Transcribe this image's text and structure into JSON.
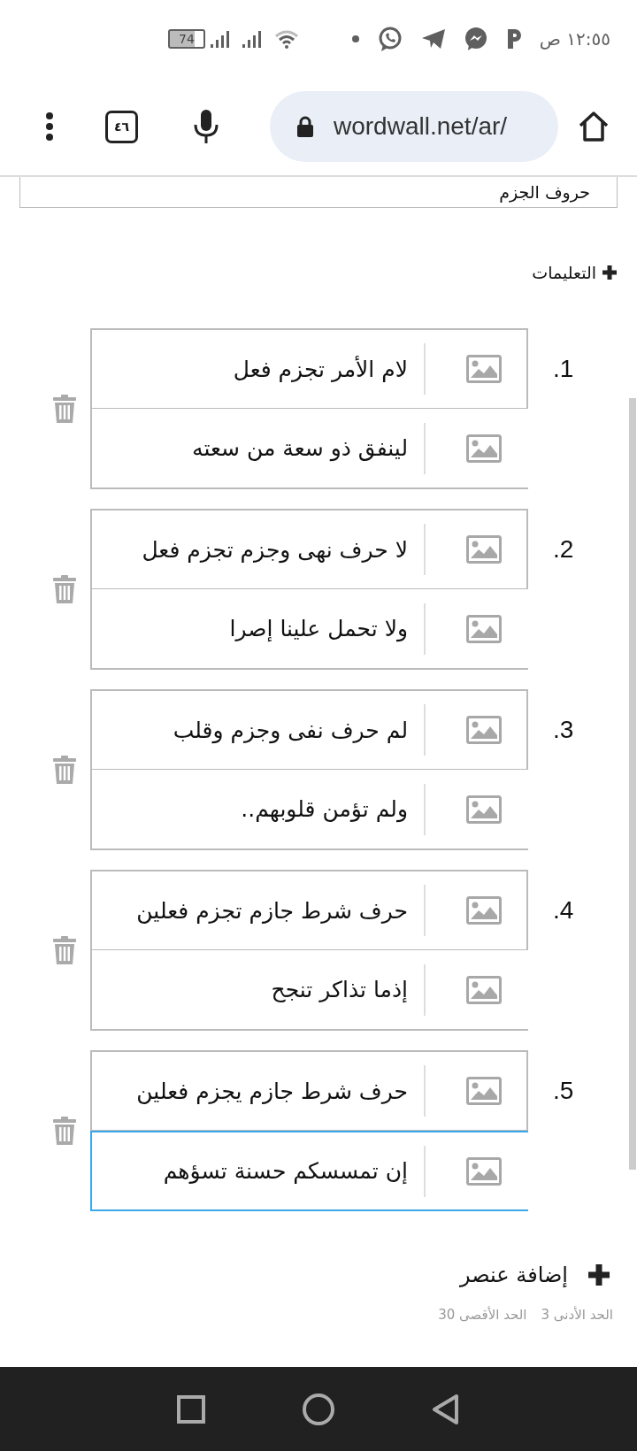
{
  "status_bar": {
    "time": "١٢:٥٥ ص",
    "battery": "74"
  },
  "browser": {
    "url": "wordwall.net/ar/",
    "tab_count": "٤٦"
  },
  "title_field": {
    "value": "حروف الجزم"
  },
  "instructions_button": {
    "label": "التعليمات"
  },
  "items": [
    {
      "number": "1.",
      "question": {
        "value": "لام الأمر تجزم فعل",
        "focused": false
      },
      "answer": {
        "value": "لينفق ذو سعة من سعته",
        "focused": false
      }
    },
    {
      "number": "2.",
      "question": {
        "value": "لا حرف نهى وجزم تجزم فعل",
        "focused": false
      },
      "answer": {
        "value": "ولا تحمل علينا إصرا",
        "focused": false
      }
    },
    {
      "number": "3.",
      "question": {
        "value": "لم حرف نفى وجزم وقلب",
        "focused": false
      },
      "answer": {
        "value": "ولم تؤمن قلوبهم..",
        "focused": false
      }
    },
    {
      "number": "4.",
      "question": {
        "value": "حرف شرط جازم تجزم فعلين",
        "focused": false
      },
      "answer": {
        "value": "إذما تذاكر تنجح",
        "focused": false
      }
    },
    {
      "number": "5.",
      "question": {
        "value": "حرف شرط جازم يجزم فعلين",
        "focused": false
      },
      "answer": {
        "value": "إن تمسسكم حسنة تسؤهم",
        "focused": true
      }
    }
  ],
  "add_item_button": {
    "label": "إضافة عنصر"
  },
  "limits": {
    "min_label": "الحد الأدنى",
    "min_value": "3",
    "max_label": "الحد الأقصى",
    "max_value": "30"
  }
}
